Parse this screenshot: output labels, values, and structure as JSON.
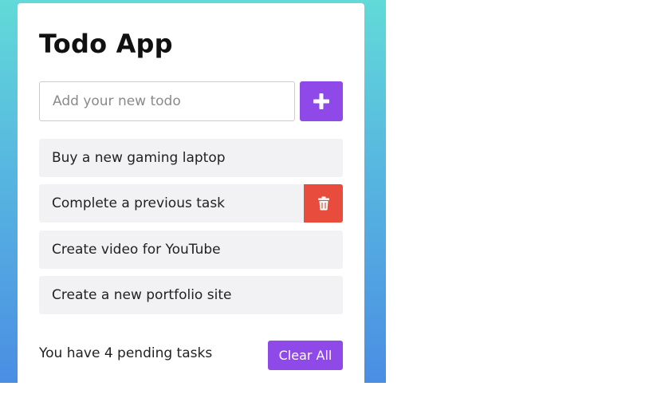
{
  "app": {
    "title": "Todo App"
  },
  "input": {
    "placeholder": "Add your new todo",
    "value": ""
  },
  "add_button": {
    "icon": "plus-icon"
  },
  "todos": [
    {
      "text": "Buy a new gaming laptop"
    },
    {
      "text": "Complete a previous task",
      "delete_icon": "trash-icon",
      "delete_visible": true
    },
    {
      "text": "Create video for YouTube"
    },
    {
      "text": "Create a new portfolio site"
    }
  ],
  "footer": {
    "pending_text": "You have 4 pending tasks",
    "clear_label": "Clear All"
  },
  "colors": {
    "accent": "#8e49e8",
    "delete": "#e74c3c",
    "item_bg": "#f2f2f4",
    "gradient_top": "#61dad8",
    "gradient_bottom": "#4a8ee3"
  }
}
